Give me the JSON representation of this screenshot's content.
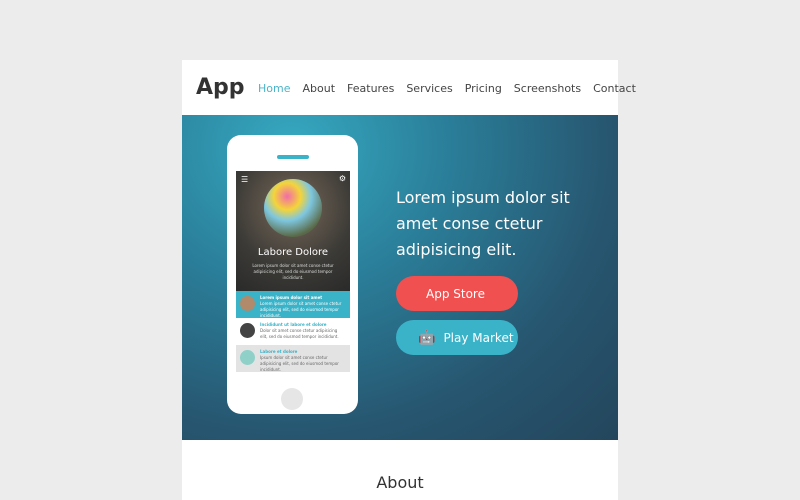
{
  "header": {
    "logo": "App",
    "nav": [
      "Home",
      "About",
      "Features",
      "Services",
      "Pricing",
      "Screenshots",
      "Contact"
    ],
    "active": "Home"
  },
  "hero": {
    "headline": "Lorem ipsum dolor sit amet conse ctetur adipisicing elit.",
    "buttons": [
      {
        "label": "App Store",
        "icon": "apple-icon",
        "color": "#f0504f"
      },
      {
        "label": "Play Market",
        "icon": "android-icon",
        "color": "#3ab3c8"
      }
    ],
    "phone": {
      "title": "Labore Dolore",
      "subtitle": "Lorem ipsum dolor sit amet conse ctetur adipisicing elit, sed do eiusmod tempor incididunt.",
      "items": [
        {
          "title": "Lorem ipsum dolor sit amet",
          "text": "Lorem ipsum dolor sit amet conse ctetur adipisicing elit, sed do eiusmod tempor incididunt."
        },
        {
          "title": "Incididunt ut labore et dolore",
          "text": "Dolor sit amet conse ctetur adipisicing elit, sed do eiusmod tempor incididunt."
        },
        {
          "title": "Labore et dolore",
          "text": "Ipsum dolor sit amet conse ctetur adipisicing elit, sed do eiusmod tempor incididunt."
        }
      ]
    }
  },
  "about": {
    "title": "About"
  }
}
